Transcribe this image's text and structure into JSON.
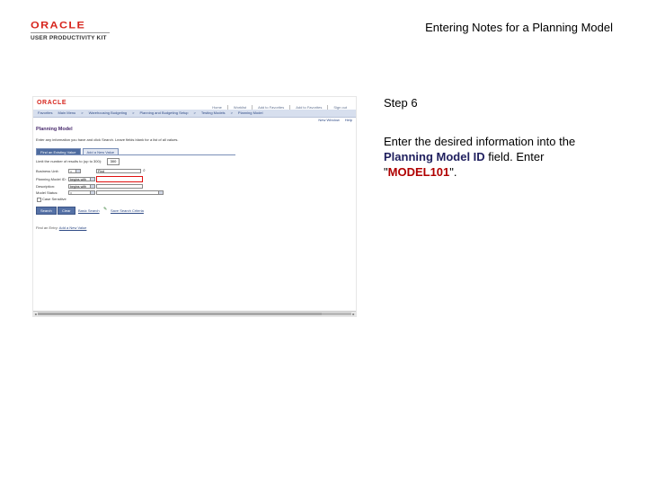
{
  "header": {
    "logo_oracle": "ORACLE",
    "logo_upk": "USER PRODUCTIVITY KIT",
    "title": "Entering Notes for a Planning Model"
  },
  "screen": {
    "oracle": "ORACLE",
    "topnav": [
      "Home",
      "Worklist",
      "Add to Favorites",
      "Add to Favorites",
      "Sign out"
    ],
    "breadcrumb": [
      "Favorites",
      "Main Menu",
      ">",
      "Warehousing Budgeting",
      ">",
      "Planning and Budgeting Setup",
      ">",
      "Testing Models",
      ">",
      "Planning Model"
    ],
    "right_links": [
      "New Window",
      "Help"
    ],
    "page_title": "Planning Model",
    "description": "Enter any information you have and click Search. Leave fields blank for a list of all values.",
    "tabs": {
      "find": "Find an Existing Value",
      "add": "Add a New Value"
    },
    "limit_label": "Limit the number of results to (up to 300):",
    "limit_value": "300",
    "fields": [
      {
        "label": "Business Unit:",
        "op": "=",
        "value": "Find"
      },
      {
        "label": "Planning Model ID:",
        "op": "begins with"
      },
      {
        "label": "Description:",
        "op": "begins with"
      },
      {
        "label": "Model Status:",
        "op": "="
      }
    ],
    "case_sensitive": "Case Sensitive",
    "buttons": {
      "search": "Search",
      "clear": "Clear",
      "basic": "Basic Search",
      "save": "Save Search Criteria"
    },
    "find_label": "Find an Entry:",
    "find_link": "Add a New Value"
  },
  "instructions": {
    "step": "Step 6",
    "line1": "Enter the desired information into the ",
    "field": "Planning Model ID",
    "line2": " field. Enter \"",
    "value": "MODEL101",
    "line3": "\"."
  }
}
